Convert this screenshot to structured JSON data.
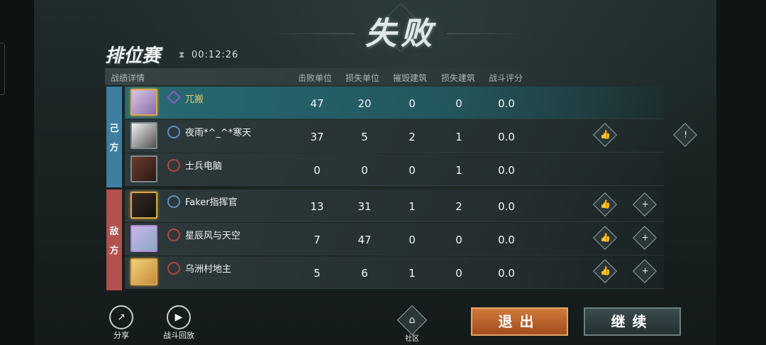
{
  "result": {
    "title": "失败"
  },
  "mode": {
    "title": "排位赛",
    "hourglass_icon": "hourglass-icon",
    "timer": "00:12:26"
  },
  "header": {
    "detail": "战绩详情",
    "columns": [
      "击败单位",
      "损失单位",
      "摧毁建筑",
      "损失建筑",
      "战斗评分"
    ]
  },
  "sides": {
    "ours": [
      "己",
      "方"
    ],
    "enemy": [
      "敌",
      "方"
    ]
  },
  "rows": [
    {
      "name": "兀搬",
      "stats": [
        "47",
        "20",
        "0",
        "0",
        "0.0"
      ]
    },
    {
      "name": "夜雨*^_^*寒天",
      "stats": [
        "37",
        "5",
        "2",
        "1",
        "0.0"
      ]
    },
    {
      "name": "士兵电脑",
      "stats": [
        "0",
        "0",
        "0",
        "1",
        "0.0"
      ]
    },
    {
      "name": "Faker指挥官",
      "stats": [
        "13",
        "31",
        "1",
        "2",
        "0.0"
      ]
    },
    {
      "name": "星辰风与天空",
      "stats": [
        "7",
        "47",
        "0",
        "0",
        "0.0"
      ]
    },
    {
      "name": "乌洲村地主",
      "stats": [
        "5",
        "6",
        "1",
        "0",
        "0.0"
      ]
    }
  ],
  "colors": {
    "ours": "#3e7ea0",
    "enemy": "#b4504f",
    "highlight": "#286e78",
    "exit": "#c0672d"
  },
  "bottom": {
    "share": "分享",
    "replay": "战斗回放",
    "community": "社区",
    "exit": "退出",
    "continue": "继续"
  }
}
